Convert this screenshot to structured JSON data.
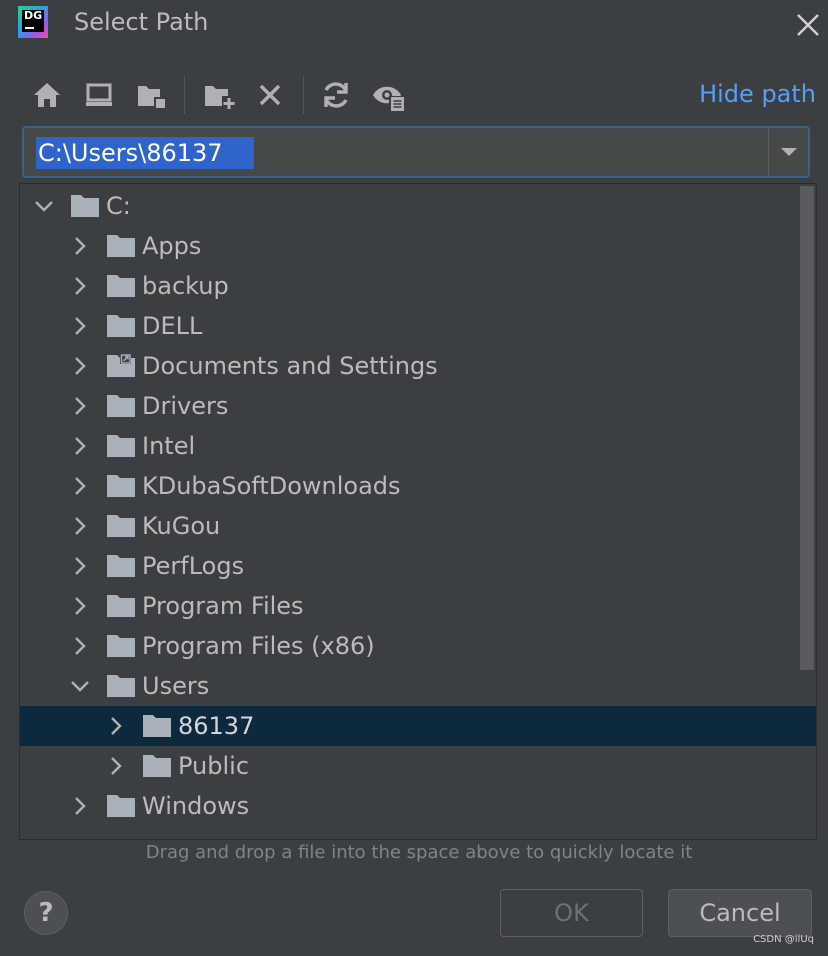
{
  "window": {
    "title": "Select Path",
    "logo_text": "DG"
  },
  "toolbar": {
    "icons": [
      "home-icon",
      "desktop-icon",
      "project-folder-icon",
      "new-folder-icon",
      "delete-icon",
      "refresh-icon",
      "show-hidden-icon"
    ],
    "hide_path_label": "Hide path"
  },
  "path": {
    "value": "C:\\Users\\86137"
  },
  "tree": {
    "rows": [
      {
        "label": "C:",
        "expanded": true
      },
      {
        "label": "Apps",
        "expanded": false
      },
      {
        "label": "backup",
        "expanded": false
      },
      {
        "label": "DELL",
        "expanded": false
      },
      {
        "label": "Documents and Settings",
        "expanded": false,
        "symlink": true
      },
      {
        "label": "Drivers",
        "expanded": false
      },
      {
        "label": "Intel",
        "expanded": false
      },
      {
        "label": "KDubaSoftDownloads",
        "expanded": false
      },
      {
        "label": "KuGou",
        "expanded": false
      },
      {
        "label": "PerfLogs",
        "expanded": false
      },
      {
        "label": "Program Files",
        "expanded": false
      },
      {
        "label": "Program Files (x86)",
        "expanded": false
      },
      {
        "label": "Users",
        "expanded": true
      },
      {
        "label": "86137",
        "expanded": false,
        "selected": true
      },
      {
        "label": "Public",
        "expanded": false
      },
      {
        "label": "Windows",
        "expanded": false
      }
    ]
  },
  "hint": "Drag and drop a file into the space above to quickly locate it",
  "buttons": {
    "help": "?",
    "ok": "OK",
    "cancel": "Cancel"
  },
  "watermark": "CSDN @ilUq",
  "colors": {
    "background": "#3c3f41",
    "selection": "#0d293e",
    "accent_link": "#589df6",
    "text_selection": "#2f65ca",
    "folder": "#a9b2bb"
  }
}
